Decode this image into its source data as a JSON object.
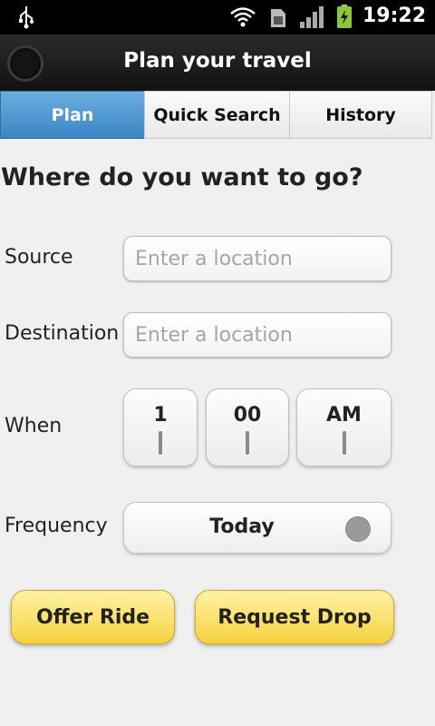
{
  "status_bar": {
    "time": "19:22",
    "icons": [
      "usb-icon",
      "wifi-icon",
      "sim-icon",
      "signal-icon",
      "battery-charging-icon"
    ]
  },
  "title_bar": {
    "title": "Plan your travel"
  },
  "tabs": [
    {
      "label": "Plan",
      "active": true
    },
    {
      "label": "Quick Search",
      "active": false
    },
    {
      "label": "History",
      "active": false
    }
  ],
  "form": {
    "headline": "Where do you want to go?",
    "source": {
      "label": "Source",
      "value": "",
      "placeholder": "Enter a location"
    },
    "destination": {
      "label": "Destination",
      "value": "",
      "placeholder": "Enter a location"
    },
    "when": {
      "label": "When",
      "hour": "1",
      "minute": "00",
      "ampm": "AM"
    },
    "frequency": {
      "label": "Frequency",
      "value": "Today"
    }
  },
  "actions": {
    "offer_ride": "Offer Ride",
    "request_drop": "Request Drop"
  },
  "colors": {
    "active_tab": "#3c86c5",
    "button_yellow": "#f7d23e",
    "title_bar": "#1a1a1a"
  }
}
